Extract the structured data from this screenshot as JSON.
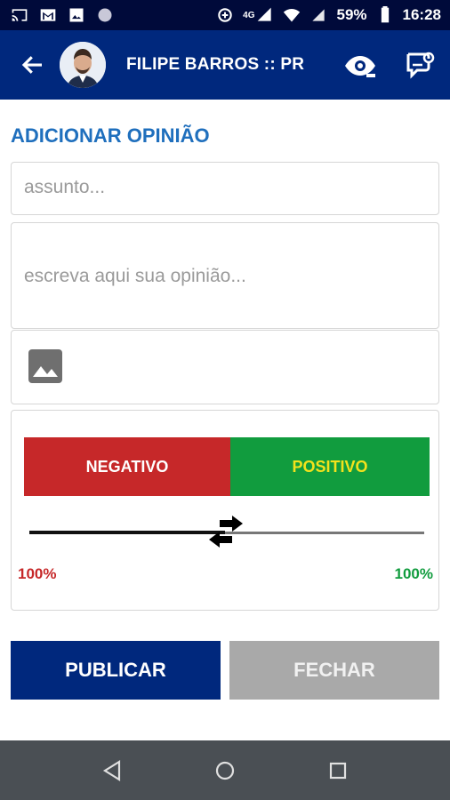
{
  "status_bar": {
    "battery": "59%",
    "time": "16:28",
    "network": "4G"
  },
  "header": {
    "title": "FILIPE BARROS :: PR"
  },
  "form": {
    "heading": "ADICIONAR OPINIÃO",
    "subject_placeholder": "assunto...",
    "opinion_placeholder": "escreva aqui sua opinião...",
    "negative_label": "NEGATIVO",
    "positive_label": "POSITIVO",
    "negative_percent": "100%",
    "positive_percent": "100%"
  },
  "actions": {
    "publish": "PUBLICAR",
    "close": "FECHAR"
  },
  "colors": {
    "appbar": "#00287d",
    "heading": "#1f6fbd",
    "negative": "#c62829",
    "positive": "#119c3e",
    "positive_text": "#f2e21c"
  }
}
